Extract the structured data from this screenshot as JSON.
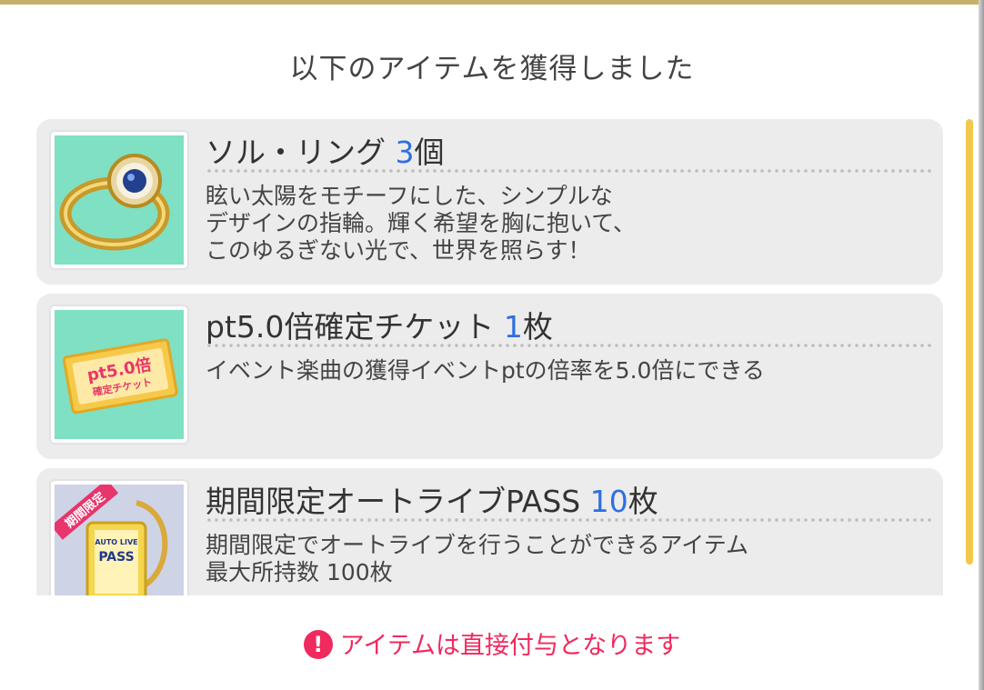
{
  "dialog": {
    "title": "以下のアイテムを獲得しました",
    "notice_icon": "!",
    "notice_text": "アイテムは直接付与となります"
  },
  "items": [
    {
      "name": "ソル・リング ",
      "qty": "3",
      "unit": "個",
      "desc": "眩い太陽をモチーフにした、シンプルな\nデザインの指輪。輝く希望を胸に抱いて、\nこのゆるぎない光で、世界を照らす！",
      "icon": "ring-icon"
    },
    {
      "name": "pt5.0倍確定チケット ",
      "qty": "1",
      "unit": "枚",
      "desc": "イベント楽曲の獲得イベントptの倍率を5.0倍にできる",
      "icon": "ticket-icon",
      "icon_text": {
        "line1": "pt5.0倍",
        "line2": "確定チケット"
      }
    },
    {
      "name": "期間限定オートライブPASS ",
      "qty": "10",
      "unit": "枚",
      "desc": "期間限定でオートライブを行うことができるアイテム\n最大所持数 100枚",
      "icon": "pass-icon",
      "icon_text": {
        "badge": "期間限定",
        "top": "AUTO LIVE",
        "main": "PASS"
      }
    }
  ],
  "colors": {
    "accent_qty": "#2f6fe0",
    "notice": "#f0295e",
    "card_bg": "#ececec",
    "thumb_bg": "#7fe0c4",
    "scrollbar": "#f2c94c",
    "top_border": "#c8b06a"
  }
}
